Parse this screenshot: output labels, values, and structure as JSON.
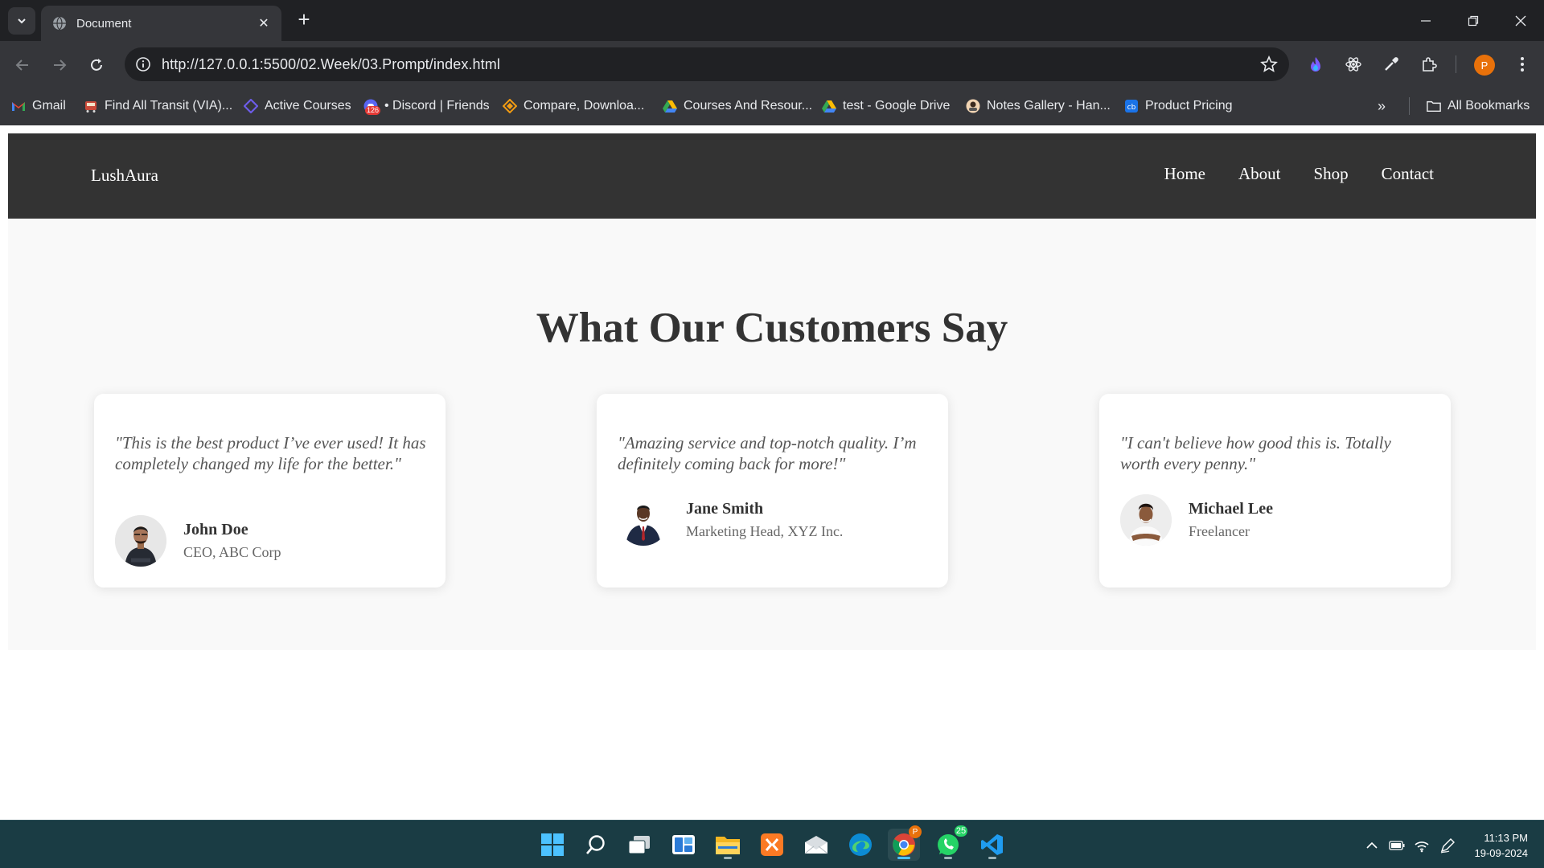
{
  "browser": {
    "tab_title": "Document",
    "url": "http://127.0.0.1:5500/02.Week/03.Prompt/index.html",
    "bookmarks": [
      {
        "label": "Gmail",
        "icon": "gmail-icon"
      },
      {
        "label": "Find All Transit (VIA)...",
        "icon": "transit-icon"
      },
      {
        "label": "Active Courses",
        "icon": "courses-icon"
      },
      {
        "label": "• Discord | Friends",
        "icon": "discord-icon",
        "badge": "126"
      },
      {
        "label": "Compare, Downloa...",
        "icon": "compare-icon"
      },
      {
        "label": "Courses And Resour...",
        "icon": "google-drive-icon"
      },
      {
        "label": "test - Google Drive",
        "icon": "google-drive-icon"
      },
      {
        "label": "Notes Gallery - Han...",
        "icon": "notes-icon"
      },
      {
        "label": "Product Pricing",
        "icon": "pricing-icon"
      }
    ],
    "all_bookmarks": "All Bookmarks",
    "profile_initial": "P"
  },
  "site": {
    "logo": "LushAura",
    "nav": [
      "Home",
      "About",
      "Shop",
      "Contact"
    ],
    "heading": "What Our Customers Say",
    "testimonials": [
      {
        "quote": "\"This is the best product I’ve ever used! It has completely changed my life for the better.\"",
        "name": "John Doe",
        "role": "CEO, ABC Corp"
      },
      {
        "quote": "\"Amazing service and top-notch quality. I’m definitely coming back for more!\"",
        "name": "Jane Smith",
        "role": "Marketing Head, XYZ Inc."
      },
      {
        "quote": "\"I can't believe how good this is. Totally worth every penny.\"",
        "name": "Michael Lee",
        "role": "Freelancer"
      }
    ]
  },
  "taskbar": {
    "whatsapp_badge": "25",
    "chrome_badge": "P",
    "time": "11:13 PM",
    "date": "19-09-2024"
  },
  "colors": {
    "header_bg": "#333333",
    "section_bg": "#f9f9f9",
    "accent_profile": "#e8710a"
  }
}
